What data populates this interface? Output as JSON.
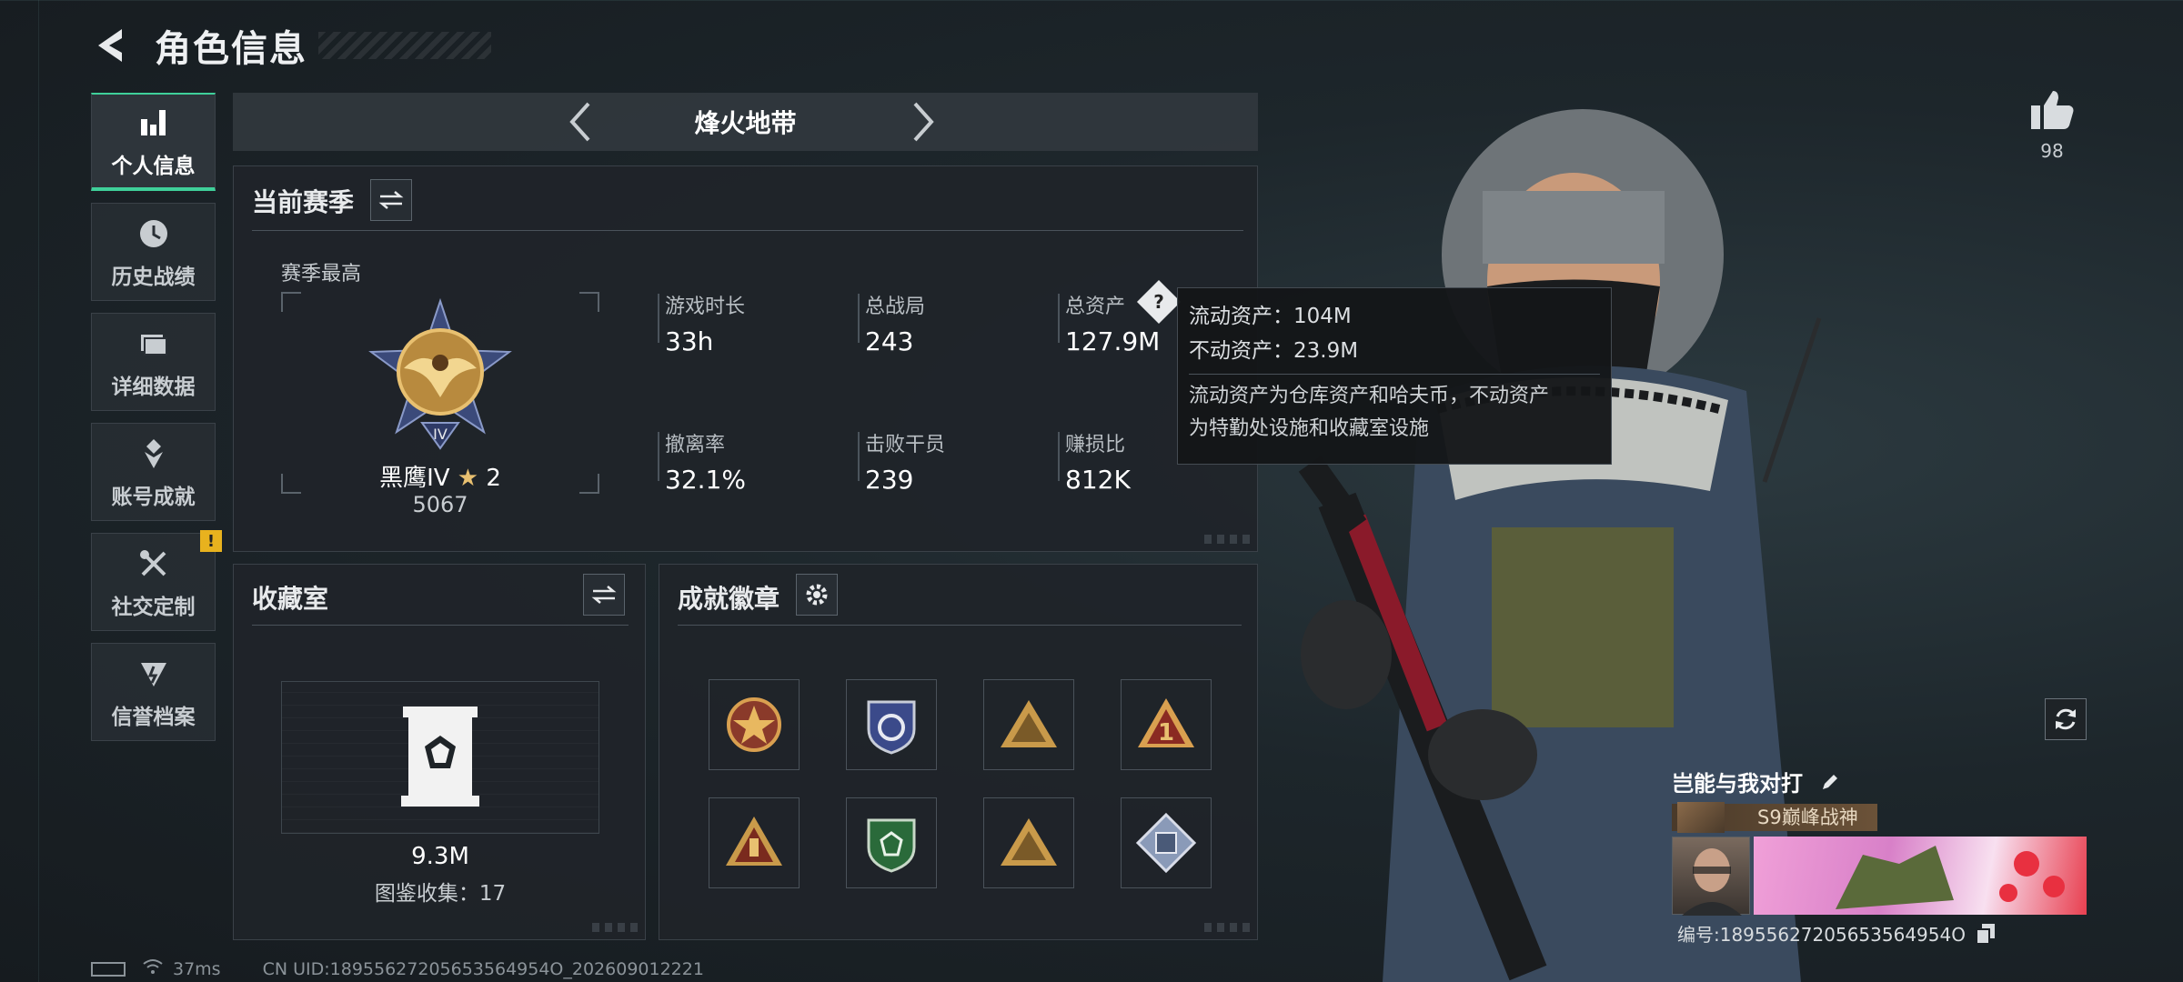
{
  "header": {
    "title": "角色信息"
  },
  "sidebar": {
    "items": [
      {
        "label": "个人信息",
        "icon": "bar-chart-icon",
        "active": true
      },
      {
        "label": "历史战绩",
        "icon": "history-clock-icon"
      },
      {
        "label": "详细数据",
        "icon": "folder-icon"
      },
      {
        "label": "账号成就",
        "icon": "achievement-medal-icon"
      },
      {
        "label": "社交定制",
        "icon": "wrench-tools-icon",
        "badge": "!"
      },
      {
        "label": "信誉档案",
        "icon": "shield-lightning-icon"
      }
    ]
  },
  "mode": {
    "title": "烽火地带"
  },
  "season": {
    "title": "当前赛季",
    "best_label": "赛季最高",
    "rank_name": "黑鹰IV",
    "rank_stars": "2",
    "rank_score": "5067",
    "stats": [
      {
        "label": "游戏时长",
        "value": "33h"
      },
      {
        "label": "总战局",
        "value": "243"
      },
      {
        "label": "总资产",
        "value": "127.9M"
      },
      {
        "label": "撤离率",
        "value": "32.1%"
      },
      {
        "label": "击败干员",
        "value": "239"
      },
      {
        "label": "赚损比",
        "value": "812K"
      }
    ]
  },
  "tooltip": {
    "liquid": "流动资产：104M",
    "fixed": "不动资产：23.9M",
    "desc_line1": "流动资产为仓库资产和哈夫币，不动资产",
    "desc_line2": "为特勤处设施和收藏室设施"
  },
  "collection": {
    "title": "收藏室",
    "value": "9.3M",
    "catalog": "图鉴收集：17"
  },
  "badges": {
    "title": "成就徽章",
    "items": [
      "star-shield-badge-icon",
      "blue-shield-badge-icon",
      "gold-triangle-badge-icon",
      "number-one-badge-icon",
      "hand-triangle-badge-icon",
      "green-shield-badge-icon",
      "gold-triangle-badge-icon",
      "diamond-cube-badge-icon"
    ]
  },
  "like": {
    "count": "98"
  },
  "player_card": {
    "name": "岂能与我对打",
    "rank_title": "S9巅峰战神",
    "id_text": "编号:18955627205653564954O"
  },
  "footer": {
    "ping": "37ms",
    "uid": "CN UID:18955627205653564954O_202609012221"
  },
  "colors": {
    "accent": "#3fd09a",
    "gold": "#c99a4a",
    "warning": "#e8b21e"
  }
}
